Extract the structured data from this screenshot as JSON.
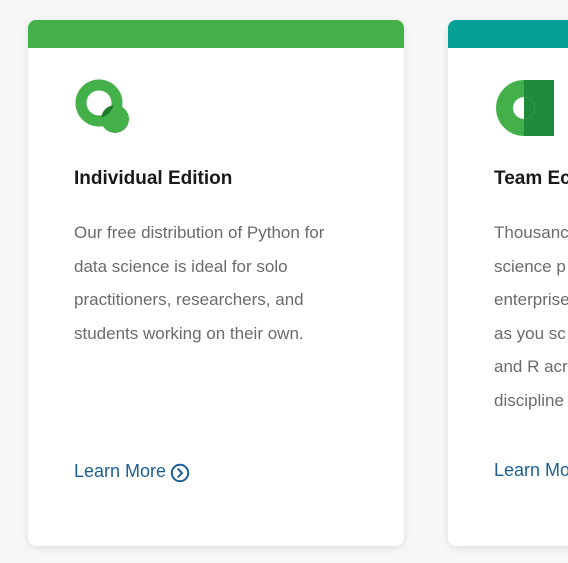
{
  "colors": {
    "individual_accent": "#43b049",
    "team_accent": "#05a098",
    "title": "#1a1a1a",
    "body_text": "#6b6b6b",
    "link": "#1b5f96"
  },
  "cards": [
    {
      "icon": "anaconda-q-logo-icon",
      "title": "Individual Edition",
      "description_lines": [
        "Our free distribution of Python for",
        "data science is ideal for solo",
        "practitioners, researchers, and",
        "students working on their own."
      ],
      "link_label": "Learn More",
      "link_icon": "chevron-right-circle-icon"
    },
    {
      "icon": "anaconda-team-logo-icon",
      "title": "Team Ec",
      "description_lines": [
        "Thousanc",
        "science p",
        "enterprise",
        "as you sc",
        "and R acr",
        "discipline"
      ],
      "link_label": "Learn Mo"
    }
  ]
}
